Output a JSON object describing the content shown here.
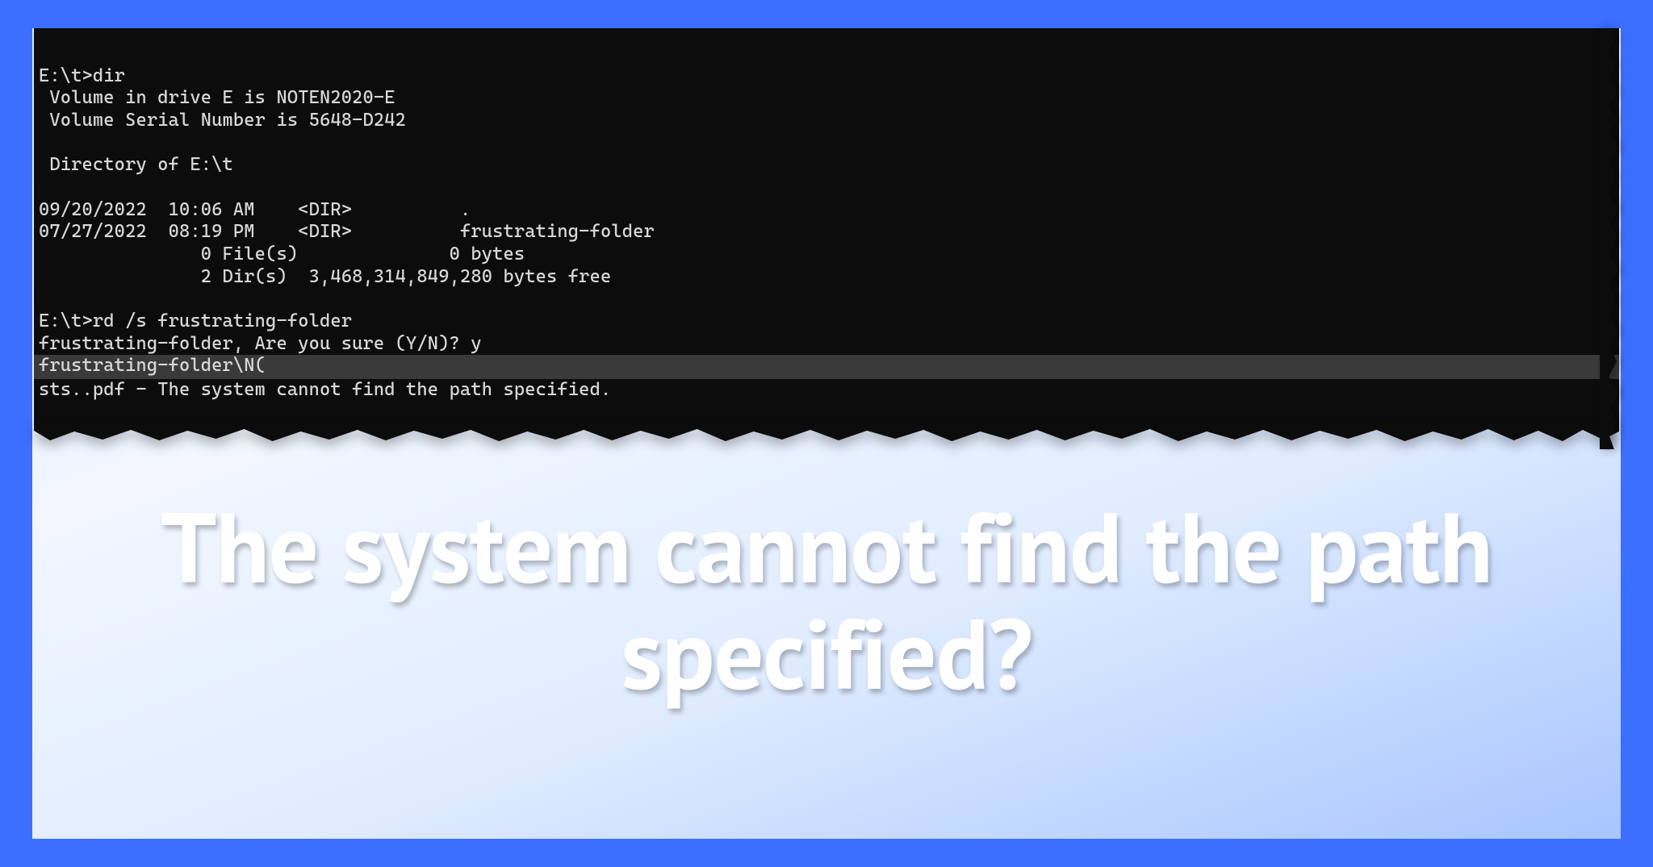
{
  "terminal": {
    "line1": "E:\\t>dir",
    "line2": " Volume in drive E is NOTEN2020-E",
    "line3": " Volume Serial Number is 5648-D242",
    "line4": "",
    "line5": " Directory of E:\\t",
    "line6": "",
    "line7": "09/20/2022  10:06 AM    <DIR>          .",
    "line8": "07/27/2022  08:19 PM    <DIR>          frustrating-folder",
    "line9": "               0 File(s)              0 bytes",
    "line10": "               2 Dir(s)  3,468,314,849,280 bytes free",
    "line11": "",
    "line12": "E:\\t>rd /s frustrating-folder",
    "line13": "frustrating-folder, Are you sure (Y/N)? y",
    "line14": "frustrating-folder\\N(",
    "line15": "",
    "line16": "sts..pdf - The system cannot find the path specified."
  },
  "headline": "The system cannot find the path specified?"
}
